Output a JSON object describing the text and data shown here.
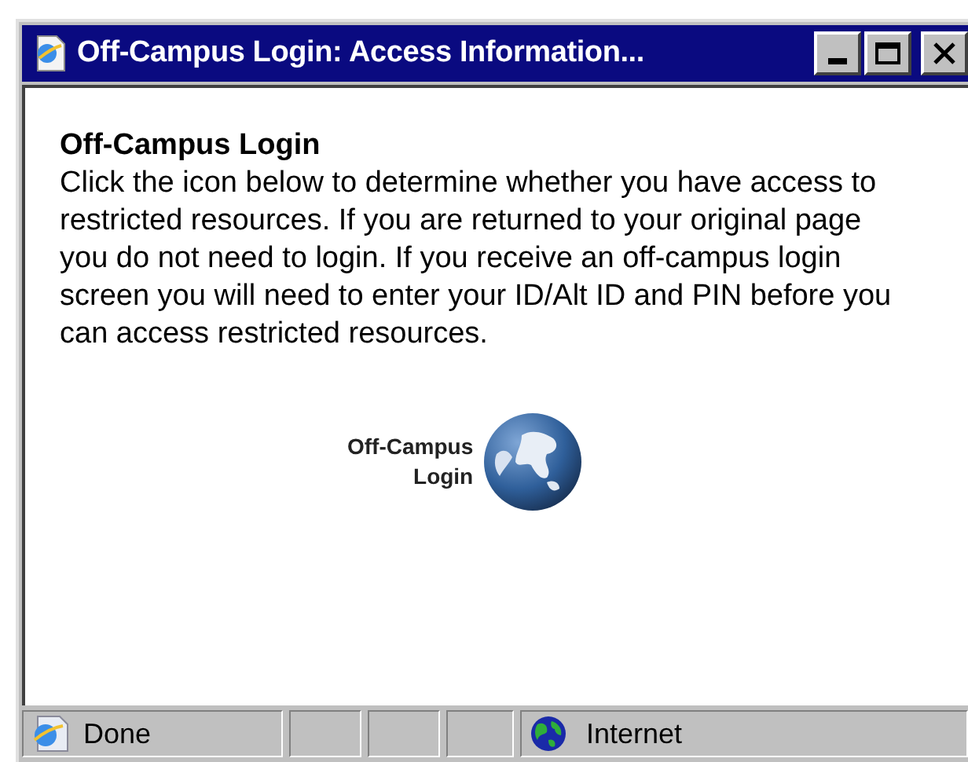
{
  "window": {
    "title": "Off-Campus Login: Access Information..."
  },
  "content": {
    "heading": "Off-Campus Login",
    "paragraph": "Click the icon below to determine whether you have access to restricted resources. If you are returned to your original page you do not need to login. If you receive an off-campus login screen you will need to enter your ID/Alt ID and PIN before you can access restricted resources.",
    "link_lines": [
      "Off-Campus",
      "Login"
    ]
  },
  "status_bar": {
    "status": "Done",
    "zone": "Internet"
  }
}
